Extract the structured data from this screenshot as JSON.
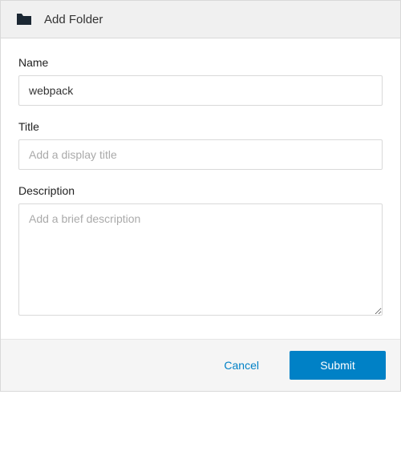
{
  "header": {
    "title": "Add Folder"
  },
  "form": {
    "name": {
      "label": "Name",
      "value": "webpack",
      "placeholder": ""
    },
    "title": {
      "label": "Title",
      "value": "",
      "placeholder": "Add a display title"
    },
    "description": {
      "label": "Description",
      "value": "",
      "placeholder": "Add a brief description"
    }
  },
  "footer": {
    "cancel_label": "Cancel",
    "submit_label": "Submit"
  }
}
